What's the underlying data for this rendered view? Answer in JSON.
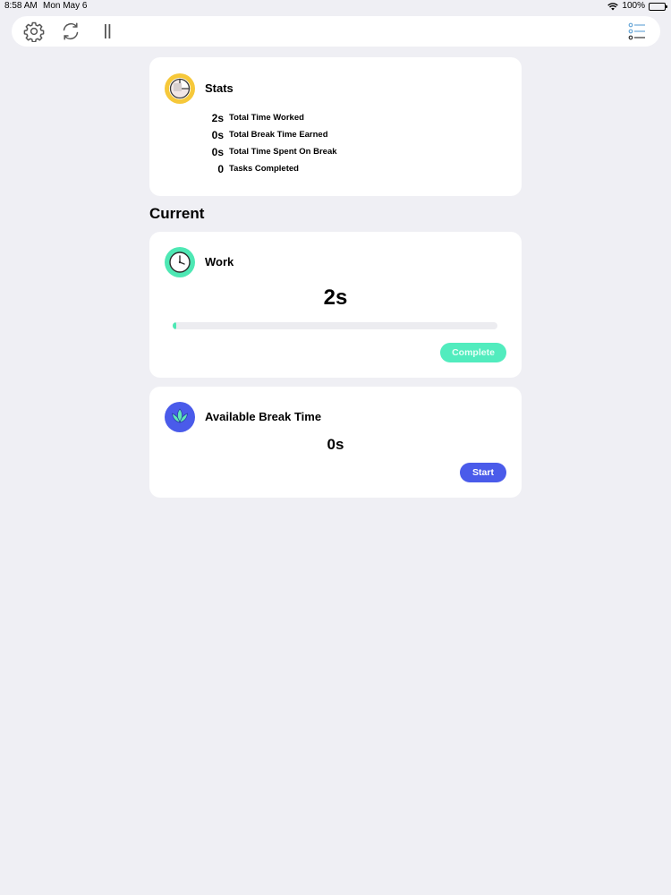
{
  "status_bar": {
    "time": "8:58 AM",
    "date": "Mon May 6",
    "battery": "100%"
  },
  "toolbar": {
    "left_icons": [
      "gear-icon",
      "refresh-icon",
      "pause-icon"
    ],
    "right_icon": "list-icon"
  },
  "stats": {
    "title": "Stats",
    "rows": [
      {
        "value": "2s",
        "label": "Total Time Worked"
      },
      {
        "value": "0s",
        "label": "Total Break Time Earned"
      },
      {
        "value": "0s",
        "label": "Total Time Spent On Break"
      },
      {
        "value": "0",
        "label": "Tasks Completed"
      }
    ]
  },
  "current_heading": "Current",
  "work": {
    "title": "Work",
    "time": "2s",
    "progress_fraction": 0.01,
    "button_label": "Complete"
  },
  "break": {
    "title": "Available Break Time",
    "time": "0s",
    "button_label": "Start"
  },
  "colors": {
    "background": "#efeff4",
    "stats_icon": "#f6c83a",
    "work_accent": "#4ee8b4",
    "break_accent": "#4a5bea"
  }
}
